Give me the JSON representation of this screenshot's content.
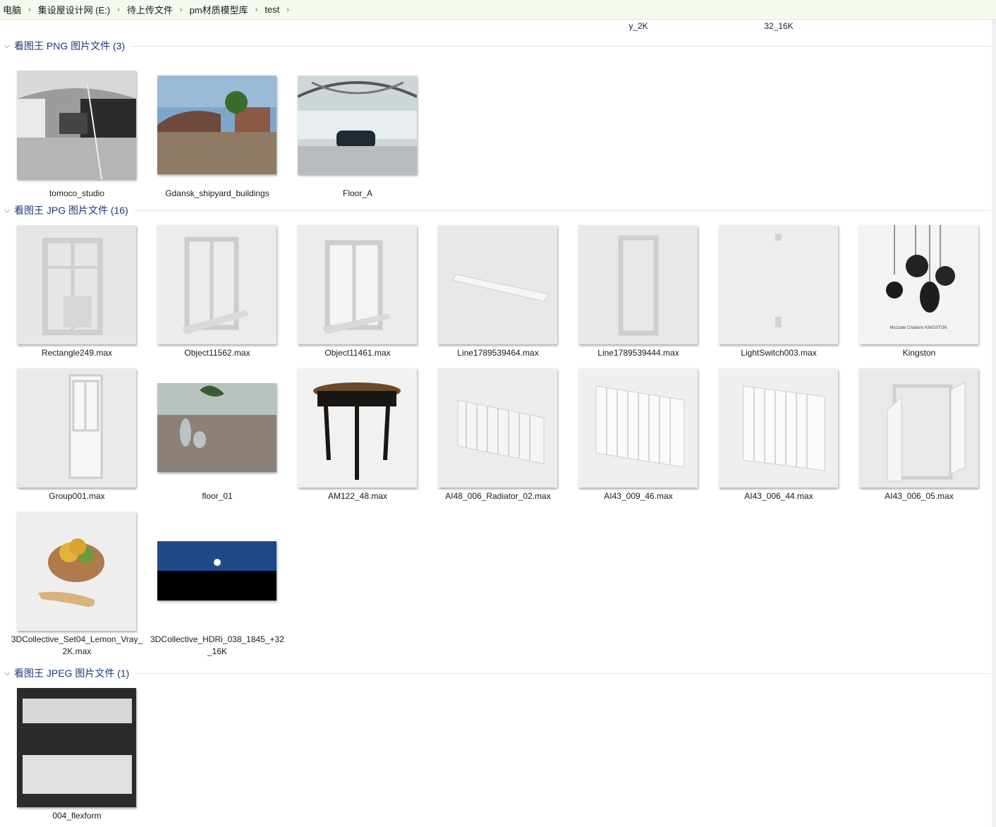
{
  "breadcrumb": [
    "电脑",
    "集设屋设计网 (E:)",
    "待上传文件",
    "pm材质模型库",
    "test"
  ],
  "top_partial_labels": [
    "y_2K",
    "32_16K"
  ],
  "groups": [
    {
      "title": "看图王 PNG 图片文件 (3)",
      "items": [
        {
          "label": "tomoco_studio"
        },
        {
          "label": "Gdansk_shipyard_buildings"
        },
        {
          "label": "Floor_A"
        }
      ]
    },
    {
      "title": "看图王 JPG 图片文件 (16)",
      "items": [
        {
          "label": "Rectangle249.max"
        },
        {
          "label": "Object11562.max"
        },
        {
          "label": "Object11461.max"
        },
        {
          "label": "Line1789539464.max"
        },
        {
          "label": "Line1789539444.max"
        },
        {
          "label": "LightSwitch003.max"
        },
        {
          "label": "Kingston",
          "caption": "Mozzate Criations KINGSTON"
        },
        {
          "label": "Group001.max"
        },
        {
          "label": "floor_01"
        },
        {
          "label": "AM122_48.max"
        },
        {
          "label": "AI48_006_Radiator_02.max"
        },
        {
          "label": "AI43_009_46.max"
        },
        {
          "label": "AI43_006_44.max"
        },
        {
          "label": "AI43_006_05.max"
        },
        {
          "label": "3DCollective_Set04_Lemon_Vray_2K.max"
        },
        {
          "label": "3DCollective_HDRi_038_1845_+32_16K"
        }
      ]
    },
    {
      "title": "看图王 JPEG 图片文件 (1)",
      "items": [
        {
          "label": "004_flexform"
        }
      ]
    }
  ]
}
